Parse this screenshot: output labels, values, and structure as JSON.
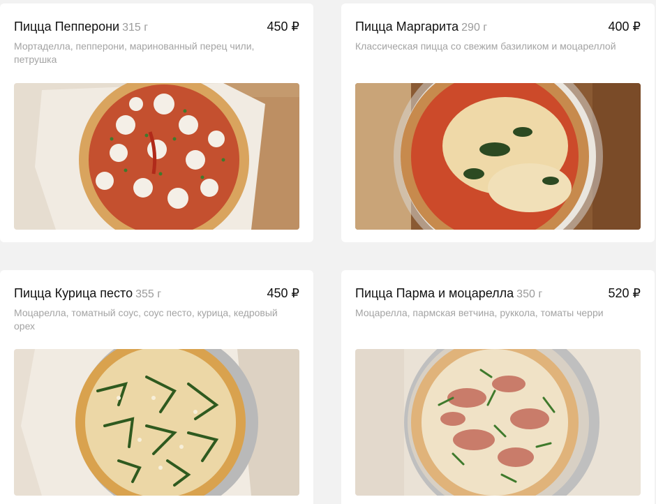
{
  "products": [
    {
      "name": "Пицца Пепперони",
      "weight": "315 г",
      "price": "450 ₽",
      "description": "Мортаделла, пепперони, маринованный перец чили, петрушка",
      "image": "pepperoni-pizza-photo"
    },
    {
      "name": "Пицца Маргарита",
      "weight": "290 г",
      "price": "400 ₽",
      "description": "Классическая пицца со свежим базиликом и моцареллой",
      "image": "margherita-pizza-photo"
    },
    {
      "name": "Пицца Курица песто",
      "weight": "355 г",
      "price": "450 ₽",
      "description": "Моцарелла, томатный соус, соус песто, курица, кедровый орех",
      "image": "chicken-pesto-pizza-photo"
    },
    {
      "name": "Пицца Парма и моцарелла",
      "weight": "350 г",
      "price": "520 ₽",
      "description": "Моцарелла, пармская ветчина, руккола, томаты черри",
      "image": "parma-mozzarella-pizza-photo"
    }
  ],
  "colors": {
    "background": "#f2f2f2",
    "card": "#ffffff",
    "title": "#111111",
    "muted": "#a3a3a3"
  }
}
